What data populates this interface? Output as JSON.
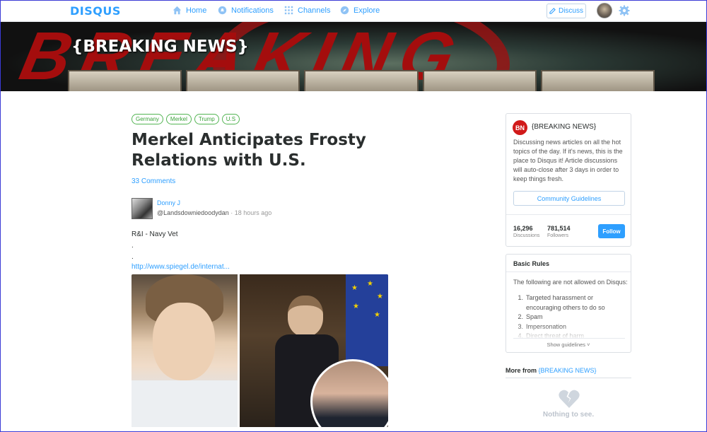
{
  "nav": {
    "logo": "DISQUS",
    "items": [
      {
        "label": "Home",
        "icon": "home-icon"
      },
      {
        "label": "Notifications",
        "icon": "bell-icon"
      },
      {
        "label": "Channels",
        "icon": "grid-icon"
      },
      {
        "label": "Explore",
        "icon": "compass-icon"
      }
    ],
    "discuss_label": "Discuss"
  },
  "banner": {
    "title": "{BREAKING NEWS}",
    "background_text": "BREAKING"
  },
  "post": {
    "tags": [
      "Germany",
      "Merkel",
      "Trump",
      "U.S"
    ],
    "title": "Merkel Anticipates Frosty Relations with U.S.",
    "comments": "33 Comments",
    "author_name": "Donny J",
    "author_handle": "@Landsdowniedoodydan",
    "separator": "·",
    "time": "18 hours ago",
    "body_lines": [
      "R&I - Navy Vet",
      ".",
      "."
    ],
    "link": "http://www.spiegel.de/internat..."
  },
  "sidebar": {
    "logo_initials": "BN",
    "channel_name": "{BREAKING NEWS}",
    "description": "Discussing news articles on all the hot topics of the day. If it's news, this is the place to Disqus it! Article discussions will auto-close after 3 days in order to keep things fresh.",
    "guidelines_button": "Community Guidelines",
    "discussions_count": "16,296",
    "discussions_label": "Discussions",
    "followers_count": "781,514",
    "followers_label": "Followers",
    "follow_button": "Follow",
    "rules_title": "Basic Rules",
    "rules_intro": "The following are not allowed on Disqus:",
    "rules": [
      {
        "num": "1.",
        "text": "Targeted harassment or encouraging others to do so"
      },
      {
        "num": "2.",
        "text": "Spam"
      },
      {
        "num": "3.",
        "text": "Impersonation"
      },
      {
        "num": "4.",
        "text": "Direct threat of harm"
      }
    ],
    "show_guidelines": "Show guidelines",
    "more_from_prefix": "More from",
    "more_from_channel": "{BREAKING NEWS}",
    "empty_text": "Nothing to see."
  },
  "colors": {
    "accent": "#2e9fff",
    "tag_green": "#3aa23a",
    "brand_red": "#d11a1a"
  }
}
